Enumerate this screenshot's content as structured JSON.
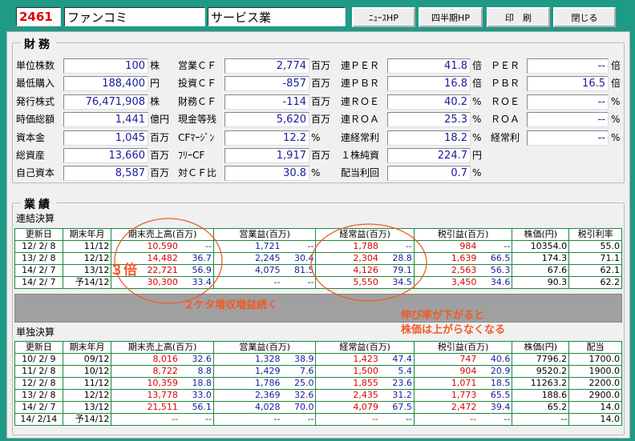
{
  "header": {
    "code": "2461",
    "company": "ファンコミ",
    "sector": "サービス業",
    "buttons": {
      "news": "ﾆｭｰｽHP",
      "quarterly": "四半期HP",
      "print": "印　刷",
      "close": "閉じる"
    }
  },
  "finance": {
    "title": "財務",
    "fields": {
      "unit_shares": {
        "label": "単位株数",
        "value": "100",
        "unit": "株"
      },
      "min_purchase": {
        "label": "最低購入",
        "value": "188,400",
        "unit": "円"
      },
      "shares_issued": {
        "label": "発行株式",
        "value": "76,471,908",
        "unit": "株"
      },
      "market_cap": {
        "label": "時価総額",
        "value": "1,441",
        "unit": "億円"
      },
      "capital": {
        "label": "資本金",
        "value": "1,045",
        "unit": "百万"
      },
      "total_assets": {
        "label": "総資産",
        "value": "13,660",
        "unit": "百万"
      },
      "equity": {
        "label": "自己資本",
        "value": "8,587",
        "unit": "百万"
      },
      "op_cf": {
        "label": "営業ＣＦ",
        "value": "2,774",
        "unit": "百万"
      },
      "inv_cf": {
        "label": "投資ＣＦ",
        "value": "-857",
        "unit": "百万"
      },
      "fin_cf": {
        "label": "財務ＣＦ",
        "value": "-114",
        "unit": "百万"
      },
      "cash": {
        "label": "現金等残",
        "value": "5,620",
        "unit": "百万"
      },
      "cf_margin": {
        "label": "CFﾏｰｼﾞﾝ",
        "value": "12.2",
        "unit": "%"
      },
      "free_cf": {
        "label": "ﾌﾘｰCF",
        "value": "1,917",
        "unit": "百万"
      },
      "cf_ratio": {
        "label": "対ＣＦ比",
        "value": "30.8",
        "unit": "%"
      },
      "cons_per": {
        "label": "連ＰＥＲ",
        "value": "41.8",
        "unit": "倍"
      },
      "cons_pbr": {
        "label": "連ＰＢＲ",
        "value": "16.8",
        "unit": "倍"
      },
      "cons_roe": {
        "label": "連ＲＯＥ",
        "value": "40.2",
        "unit": "%"
      },
      "cons_roa": {
        "label": "連ＲＯＡ",
        "value": "25.3",
        "unit": "%"
      },
      "cons_ord": {
        "label": "連経常利",
        "value": "18.2",
        "unit": "%"
      },
      "bps": {
        "label": "１株純資",
        "value": "224.7",
        "unit": "円"
      },
      "yield": {
        "label": "配当利回",
        "value": "0.7",
        "unit": "%"
      },
      "per": {
        "label": "ＰＥＲ",
        "value": "--",
        "unit": "倍"
      },
      "pbr": {
        "label": "ＰＢＲ",
        "value": "16.5",
        "unit": "倍"
      },
      "roe": {
        "label": "ＲＯＥ",
        "value": "--",
        "unit": "%"
      },
      "roa": {
        "label": "ＲＯＡ",
        "value": "--",
        "unit": "%"
      },
      "ord": {
        "label": "経常利",
        "value": "--",
        "unit": "%"
      }
    }
  },
  "performance": {
    "title": "業績",
    "consolidated_label": "連結決算",
    "standalone_label": "単独決算",
    "cons_headers": [
      "更新日",
      "期末年月",
      "期末売上高(百万)",
      "営業益(百万)",
      "経常益(百万)",
      "税引益(百万)",
      "株価(円)",
      "税引利率"
    ],
    "std_headers": [
      "更新日",
      "期末年月",
      "期末売上高(百万)",
      "営業益(百万)",
      "経常益(百万)",
      "税引益(百万)",
      "株価(円)",
      "配当"
    ],
    "consolidated": [
      [
        "12/ 2/ 8",
        "11/12",
        "10,590",
        "--",
        "1,721",
        "--",
        "1,788",
        "--",
        "984",
        "--",
        "10354.0",
        "55.0"
      ],
      [
        "13/ 2/ 8",
        "12/12",
        "14,482",
        "36.7",
        "2,245",
        "30.4",
        "2,304",
        "28.8",
        "1,639",
        "66.5",
        "174.3",
        "71.1"
      ],
      [
        "14/ 2/ 7",
        "13/12",
        "22,721",
        "56.9",
        "4,075",
        "81.5",
        "4,126",
        "79.1",
        "2,563",
        "56.3",
        "67.6",
        "62.1"
      ],
      [
        "14/ 2/ 7",
        "予14/12",
        "30,300",
        "33.4",
        "--",
        "--",
        "5,550",
        "34.5",
        "3,450",
        "34.6",
        "90.3",
        "62.2"
      ]
    ],
    "standalone": [
      [
        "10/ 2/ 9",
        "09/12",
        "8,016",
        "32.6",
        "1,328",
        "38.9",
        "1,423",
        "47.4",
        "747",
        "40.6",
        "7796.2",
        "1700.0"
      ],
      [
        "11/ 2/ 8",
        "10/12",
        "8,722",
        "8.8",
        "1,429",
        "7.6",
        "1,500",
        "5.4",
        "904",
        "20.9",
        "9520.2",
        "1900.0"
      ],
      [
        "12/ 2/ 8",
        "11/12",
        "10,359",
        "18.8",
        "1,786",
        "25.0",
        "1,855",
        "23.6",
        "1,071",
        "18.5",
        "11263.2",
        "2200.0"
      ],
      [
        "13/ 2/ 8",
        "12/12",
        "13,778",
        "33.0",
        "2,369",
        "32.6",
        "2,435",
        "31.2",
        "1,773",
        "65.5",
        "188.6",
        "2900.0"
      ],
      [
        "14/ 2/ 7",
        "13/12",
        "21,511",
        "56.1",
        "4,028",
        "70.0",
        "4,079",
        "67.5",
        "2,472",
        "39.4",
        "65.2",
        "14.0"
      ],
      [
        "14/ 2/14",
        "予14/12",
        "--",
        "--",
        "--",
        "--",
        "--",
        "--",
        "--",
        "--",
        "--",
        "14.0"
      ]
    ]
  },
  "annotations": {
    "three_times": "３倍",
    "two_digit_growth": "２ケタ増収増益続く",
    "growth_note_1": "伸び率が下がると",
    "growth_note_2": "株価は上がらなくなる",
    "color": "#f05a28"
  }
}
